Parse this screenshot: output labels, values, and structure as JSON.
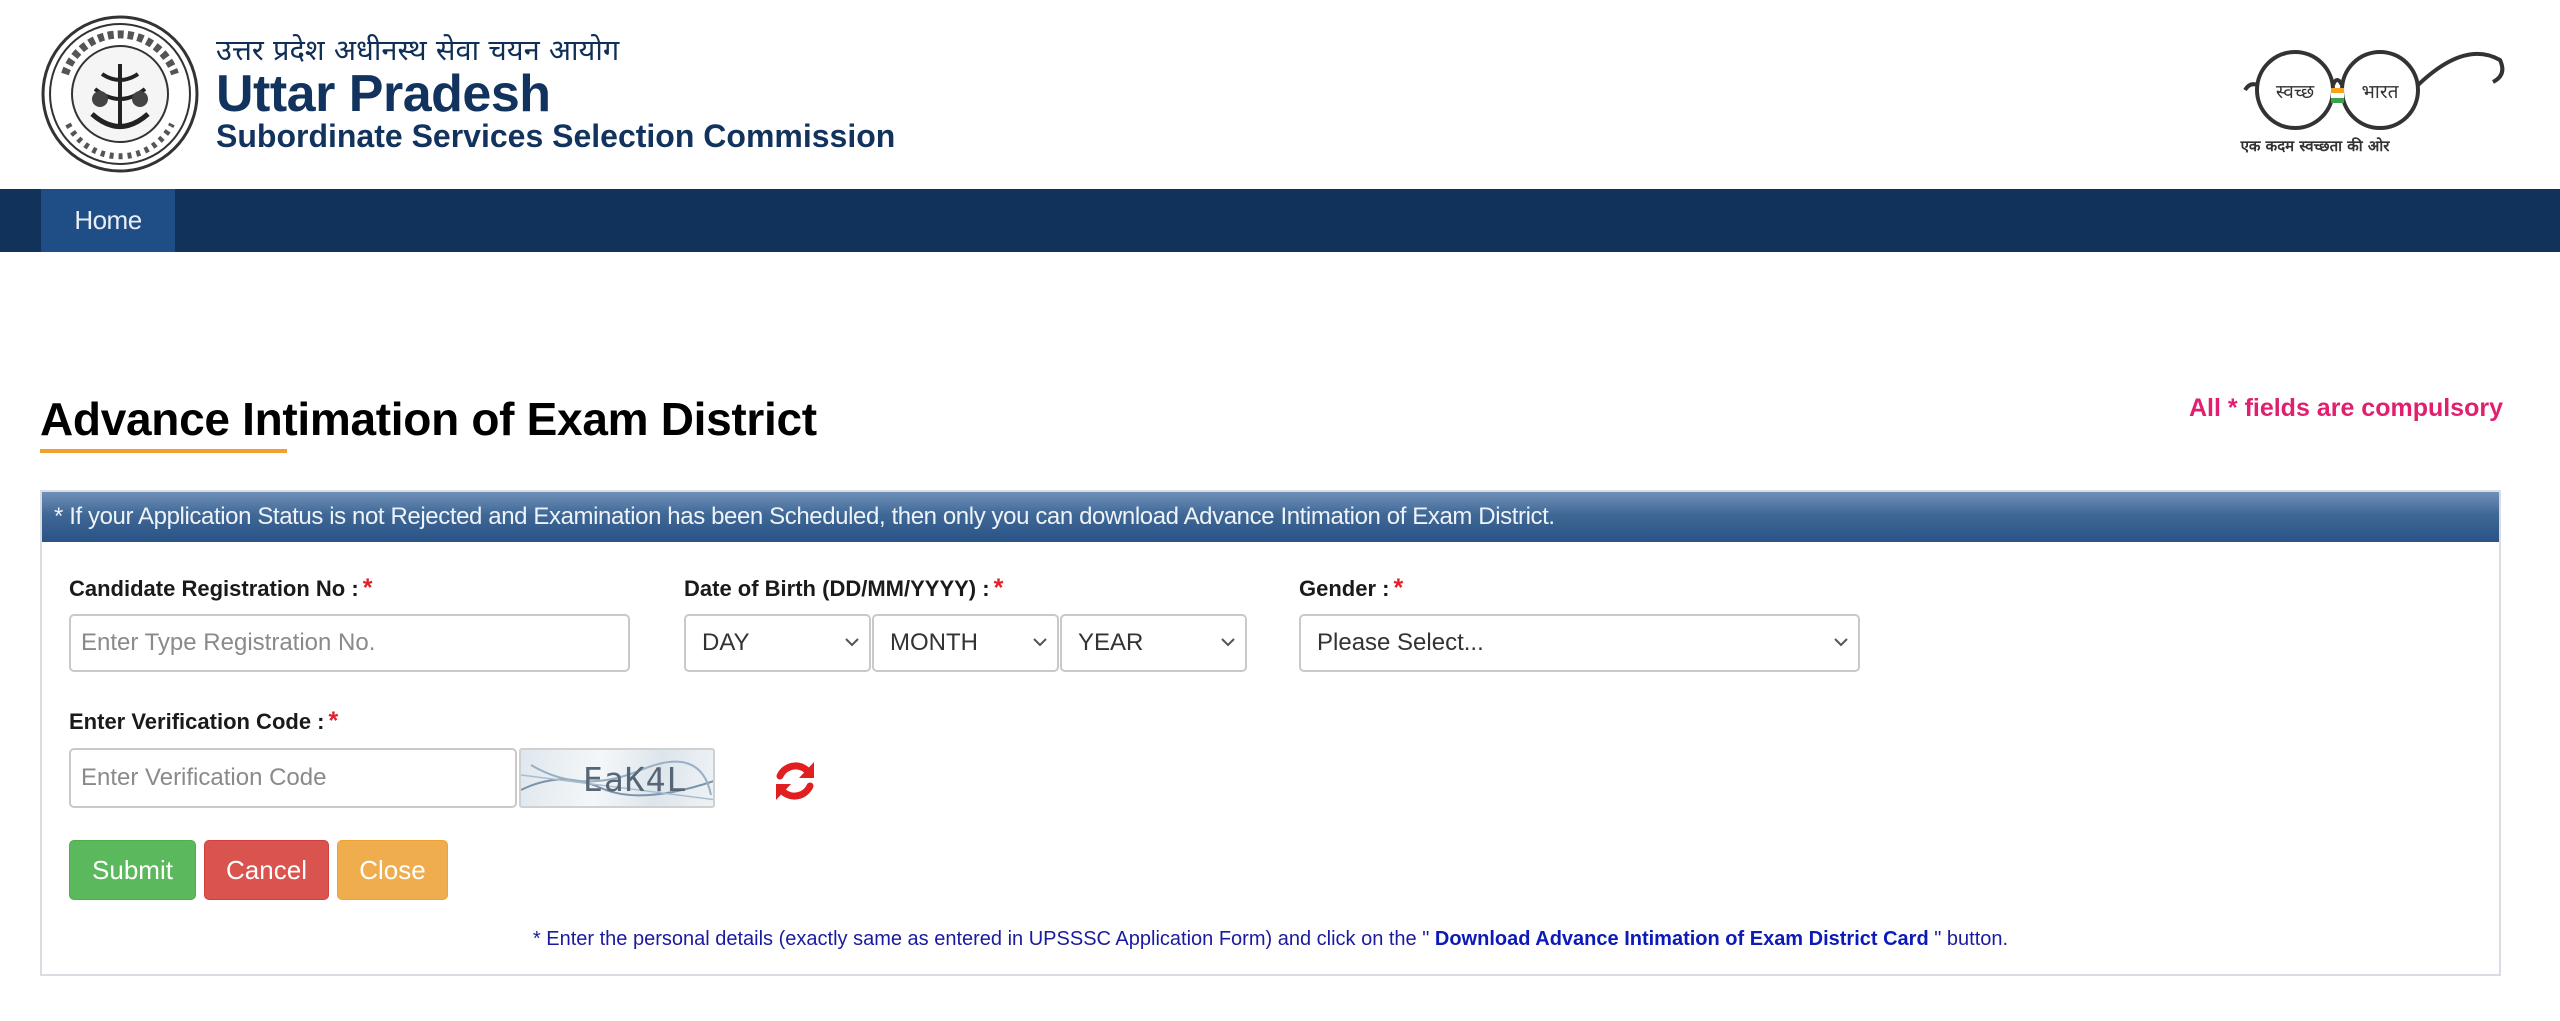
{
  "header": {
    "hindi_title": "उत्तर प्रदेश अधीनस्थ सेवा चयन आयोग",
    "title": "Uttar Pradesh",
    "subtitle": "Subordinate Services Selection Commission",
    "swachh_left": "स्वच्छ",
    "swachh_right": "भारत",
    "swachh_tagline": "एक कदम स्वच्छता की ओर"
  },
  "nav": {
    "items": [
      {
        "label": "Home",
        "active": true
      }
    ]
  },
  "page": {
    "title": "Advance Intimation of Exam District",
    "compulsory_note": "All * fields are compulsory"
  },
  "panel": {
    "heading": "* If your Application Status is not Rejected and Examination has been Scheduled, then only you can download Advance Intimation of Exam District.",
    "fields": {
      "registration": {
        "label": "Candidate Registration No :",
        "placeholder": "Enter Type Registration No."
      },
      "dob": {
        "label": "Date of Birth (DD/MM/YYYY) :",
        "day": "DAY",
        "month": "MONTH",
        "year": "YEAR"
      },
      "gender": {
        "label": "Gender :",
        "value": "Please Select..."
      },
      "verification": {
        "label": "Enter Verification Code :",
        "placeholder": "Enter Verification Code",
        "captcha": "EaK4L"
      }
    },
    "required_mark": "*",
    "buttons": {
      "submit": "Submit",
      "cancel": "Cancel",
      "close": "Close"
    },
    "note_prefix": "* Enter the personal details (exactly same as entered in UPSSSC Application Form) and click on the \"",
    "note_link": " Download Advance Intimation of Exam District Card ",
    "note_suffix": "\" button."
  },
  "colors": {
    "navbar": "#11325a",
    "nav_active": "#1f4d86",
    "accent_underline": "#f0a030",
    "required": "#e0202a",
    "compulsory_text": "#e0206f",
    "submit": "#5cb85c",
    "cancel": "#d9534f",
    "close": "#f0ad4e",
    "refresh_icon": "#e02020"
  }
}
